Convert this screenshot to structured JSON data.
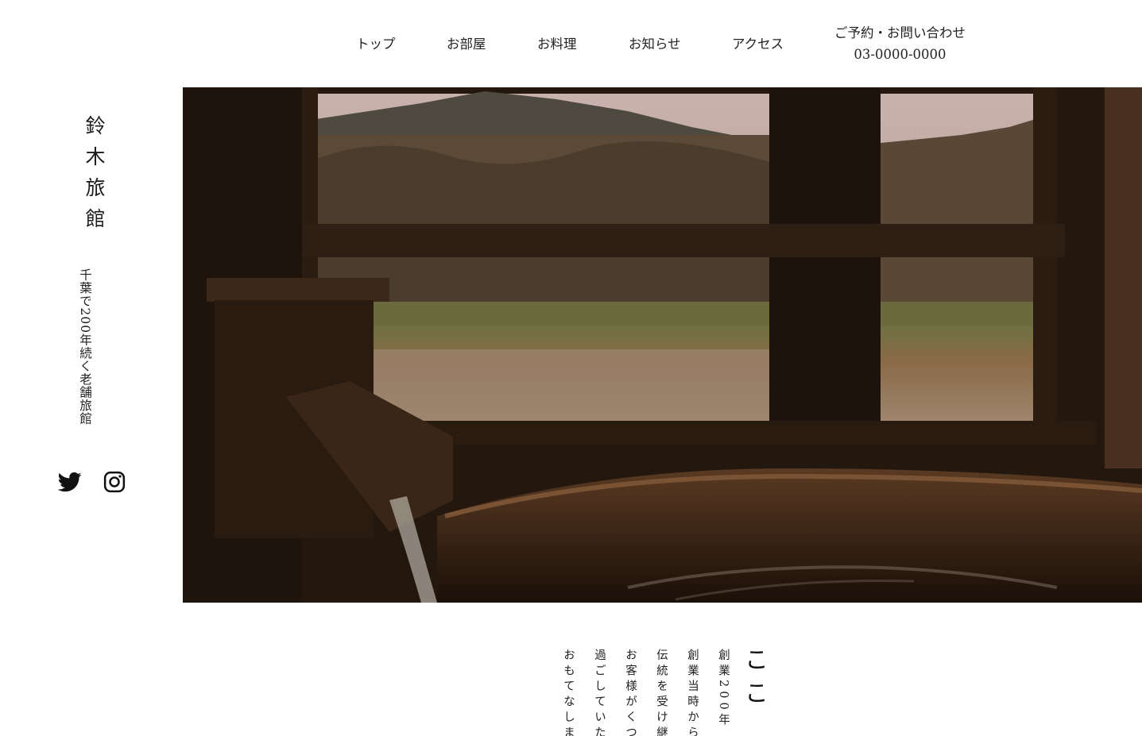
{
  "brand": {
    "title": "鈴木旅館",
    "tagline": "千葉で200年続く老舗旅館"
  },
  "social": {
    "twitter_icon": "twitter-icon",
    "instagram_icon": "instagram-icon"
  },
  "nav": {
    "items": [
      {
        "label": "トップ"
      },
      {
        "label": "お部屋"
      },
      {
        "label": "お料理"
      },
      {
        "label": "お知らせ"
      },
      {
        "label": "アクセス"
      }
    ],
    "contact": {
      "label": "ご予約・お問い合わせ",
      "phone": "03-0000-0000"
    }
  },
  "intro": {
    "heading": "ここ",
    "lines": [
      "創業200年",
      "創業当時から",
      "伝統を受け継",
      "お客様がくつ",
      "過ごしていた",
      "おもてなしま"
    ]
  },
  "colors": {
    "background": "#ffffff",
    "text": "#222222",
    "hero_dark": "#1c120b"
  }
}
